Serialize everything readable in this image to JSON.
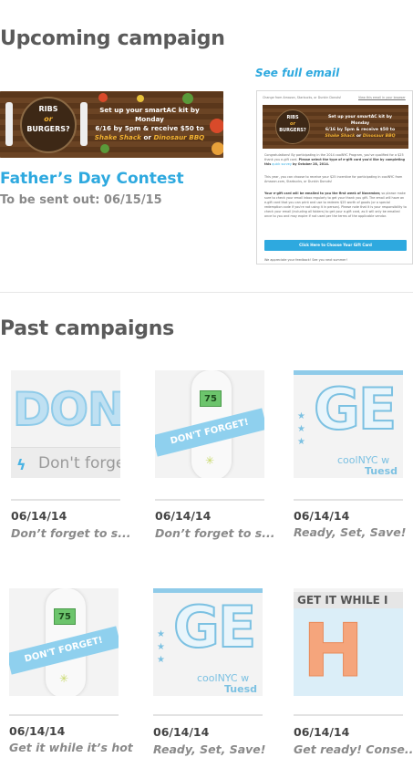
{
  "upcoming": {
    "heading": "Upcoming campaign",
    "see_full_email": "See full email",
    "campaign_title": "Father’s Day Contest",
    "sent_out": "To be sent out: 06/15/15",
    "banner": {
      "ribs": "RIBS",
      "or": "or",
      "burgers": "BURGERS?",
      "line1": "Set up your smartAC kit by Monday",
      "line2": "6/16 by 5pm & receive $50 to",
      "shake": "Shake Shack",
      "or2": "or",
      "dino": "Dinosaur BBQ"
    },
    "email": {
      "from_line": "Change from Amazon, Starbucks, or Dunkin Donuts!",
      "view_online": "View this email in your browser",
      "p1": "Congratulations! By participating in the 2014 coolNYC Program, you've qualified for a $25 thank you e-gift card.",
      "p1_bold": "Please select the type of e-gift card you'd like by completing this",
      "p1_link": "quick survey",
      "p1_end": "by October 28, 2014.",
      "p2": "This year, you can choose to receive your $25 incentive for participating in coolNYC from Amazon.com, Starbucks, or Dunkin Donuts!",
      "p3_bold": "Your e-gift card will be emailed to you the first week of November,",
      "p3": "so please make sure to check your email inbox regularly to get your thank you gift. The email will have an e-gift card that you can print and use to redeem $25 worth of goods (or a special redemption code if you're not using it in person). Please note that it is your responsibility to check your email (including all folders) to get your e-gift card, as it will only be emailed once to you and may expire if not used per the terms of the applicable vendor.",
      "cta": "Click Here to Choose Your Gift Card",
      "footer": "We appreciate your feedback! See you next summer!"
    }
  },
  "past": {
    "heading": "Past campaigns",
    "items": [
      {
        "date": "06/14/14",
        "desc": "Don’t forget to s...",
        "art": {
          "big": "DON",
          "sub": "Don't forge"
        }
      },
      {
        "date": "06/14/14",
        "desc": "Don’t forget to s...",
        "art": {
          "screen": "75",
          "ribbon": "DON'T FORGET!"
        }
      },
      {
        "date": "06/14/14",
        "desc": "Ready, Set, Save!",
        "art": {
          "big": "GE",
          "sub": "coolNYC w",
          "sub2": "Tuesd"
        }
      },
      {
        "date": "06/14/14",
        "desc": "Get it while it’s hot",
        "art": {
          "screen": "75",
          "ribbon": "DON'T FORGET!"
        }
      },
      {
        "date": "06/14/14",
        "desc": "Ready, Set, Save!",
        "art": {
          "big": "GE",
          "sub": "coolNYC w",
          "sub2": "Tuesd"
        }
      },
      {
        "date": "06/14/14",
        "desc": "Get ready! Conse...",
        "art": {
          "top": "GET IT WHILE I",
          "big": "H"
        }
      }
    ]
  }
}
